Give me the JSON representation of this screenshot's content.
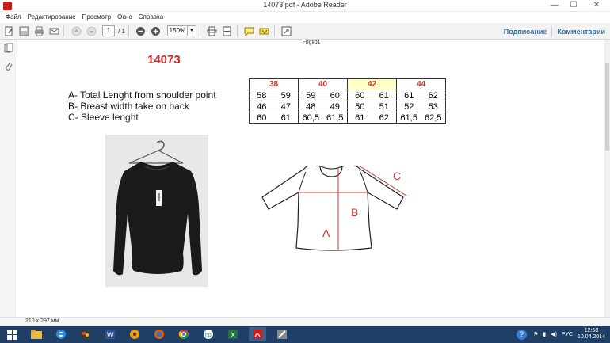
{
  "window": {
    "title": "14073.pdf - Adobe Reader",
    "controls": {
      "minimize": "—",
      "maximize": "☐",
      "close": "✕"
    }
  },
  "menu": [
    "Файл",
    "Редактирование",
    "Просмотр",
    "Окно",
    "Справка"
  ],
  "toolbar": {
    "page_current": "1",
    "page_count": "/ 1",
    "zoom": "150%",
    "links": {
      "sign": "Подписание",
      "comments": "Комментарии"
    }
  },
  "document": {
    "sheet_name": "Foglio1",
    "model_number": "14073",
    "measures": [
      "A- Total Lenght from shoulder point",
      "B- Breast width take on back",
      "C- Sleeve lenght"
    ],
    "size_table": {
      "headers": [
        "38",
        "40",
        "42",
        "44"
      ],
      "highlighted_size": "42",
      "rows": [
        [
          "58",
          "59",
          "59",
          "60",
          "60",
          "61",
          "61",
          "62"
        ],
        [
          "46",
          "47",
          "48",
          "49",
          "50",
          "51",
          "52",
          "53"
        ],
        [
          "60",
          "61",
          "60,5",
          "61,5",
          "61",
          "62",
          "61,5",
          "62,5"
        ]
      ]
    },
    "diagram_labels": {
      "a": "A",
      "b": "B",
      "c": "C"
    },
    "colors": {
      "model_number": "#d12a2a",
      "size_header": "#c0392b",
      "highlight": "#ffffc8",
      "diagram_line": "#c0392b"
    }
  },
  "status": {
    "page_size": "210 x 297 мм"
  },
  "taskbar": {
    "apps": [
      "windows-start-icon",
      "folder-icon",
      "internet-explorer-icon",
      "game-icon",
      "word-icon",
      "audio-player-icon",
      "firefox-icon",
      "chrome-icon",
      "hp-icon",
      "excel-icon",
      "acrobat-icon",
      "tools-icon"
    ],
    "language": "РУС",
    "time": "12:58",
    "date": "10.04.2014"
  }
}
